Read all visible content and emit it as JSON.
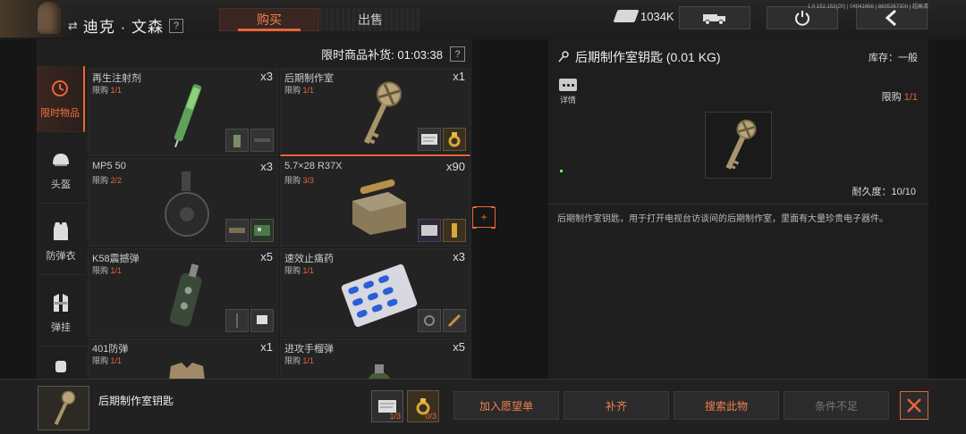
{
  "header": {
    "player_name": "迪克 · 文森",
    "help": "?",
    "tabs": {
      "buy": "购买",
      "sell": "出售"
    },
    "cash": "1034K",
    "version": "1.0.152.152(20) | 04041656 | 8835287300 | 超高清"
  },
  "shop": {
    "restock_label": "限时商品补货: 01:03:38",
    "help": "?",
    "categories": [
      {
        "label": "限时物品",
        "icon": "clock-icon"
      },
      {
        "label": "头盔",
        "icon": "helmet-icon"
      },
      {
        "label": "防弹衣",
        "icon": "vest-icon"
      },
      {
        "label": "弹挂",
        "icon": "rig-icon"
      }
    ],
    "items": [
      {
        "name": "再生注射剂",
        "limit_prefix": "限购 ",
        "limit": "1/1",
        "qty": "x3"
      },
      {
        "name": "后期制作室",
        "limit_prefix": "限购 ",
        "limit": "1/1",
        "qty": "x1"
      },
      {
        "name": "MP5 50",
        "limit_prefix": "限购 ",
        "limit": "2/2",
        "qty": "x3"
      },
      {
        "name": "5.7×28 R37X",
        "limit_prefix": "限购 ",
        "limit": "3/3",
        "qty": "x90"
      },
      {
        "name": "K58震撼弹",
        "limit_prefix": "限购 ",
        "limit": "1/1",
        "qty": "x5"
      },
      {
        "name": "速效止痛药",
        "limit_prefix": "限购 ",
        "limit": "1/1",
        "qty": "x3"
      },
      {
        "name": "401防弹",
        "limit_prefix": "限购 ",
        "limit": "1/1",
        "qty": "x1"
      },
      {
        "name": "进攻手榴弹",
        "limit_prefix": "限购 ",
        "limit": "1/1",
        "qty": "x5"
      }
    ],
    "side_marker": "+"
  },
  "detail": {
    "title": "后期制作室钥匙 (0.01 KG)",
    "stock": "库存：一般",
    "detail_link": "详情",
    "purchase_limit_prefix": "限购 ",
    "purchase_limit_have": "1",
    "purchase_limit_total": "/1",
    "durability": "耐久度：10/10",
    "description": "后期制作室钥匙，用于打开电视台访谈间的后期制作室，里面有大量珍贵电子器件。"
  },
  "bottom": {
    "selected_name": "后期制作室钥匙",
    "req1_count": "1/3",
    "req2_count": "0/3",
    "buttons": {
      "wishlist": "加入愿望单",
      "fill": "补齐",
      "search": "搜索此物",
      "condition": "条件不足"
    }
  },
  "colors": {
    "accent": "#e8653a",
    "panel": "#1f1f1f",
    "background": "#161616"
  }
}
